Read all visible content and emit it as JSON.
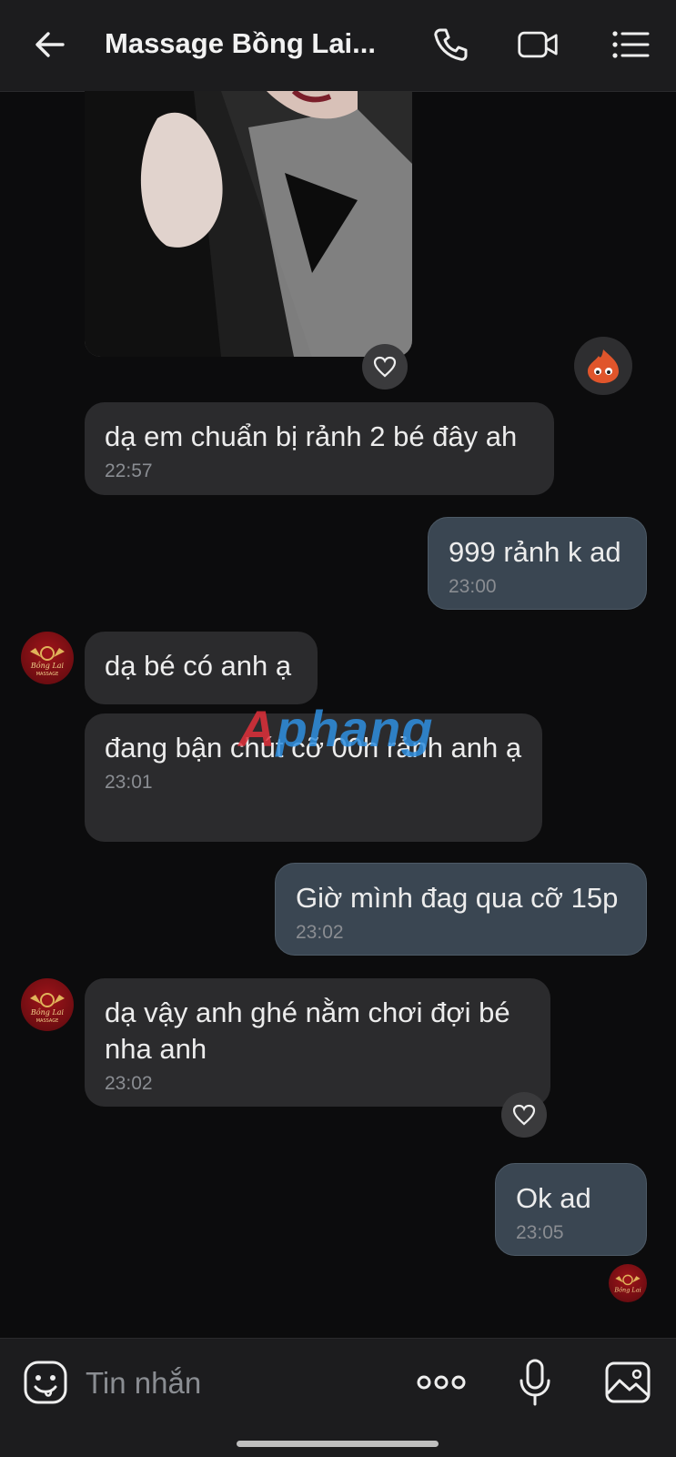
{
  "header": {
    "title": "Massage Bồng Lai...",
    "icons": [
      "back-arrow-icon",
      "phone-icon",
      "video-icon",
      "menu-list-icon"
    ]
  },
  "messages": [
    {
      "direction": "incoming",
      "text": "dạ em chuẩn bị rảnh 2 bé đây ah",
      "time": "22:57"
    },
    {
      "direction": "outgoing",
      "text": "999 rảnh k ad",
      "time": "23:00"
    },
    {
      "direction": "incoming",
      "text": "dạ bé có anh ạ",
      "time": ""
    },
    {
      "direction": "incoming",
      "text": "đang bận chút cỡ 00h rảnh anh ạ",
      "time": "23:01"
    },
    {
      "direction": "outgoing",
      "text": "Giờ mình đag qua cỡ 15p",
      "time": "23:02"
    },
    {
      "direction": "incoming",
      "text": "dạ vậy anh ghé nằm chơi đợi bé nha anh",
      "time": "23:02"
    },
    {
      "direction": "outgoing",
      "text": "Ok ad",
      "time": "23:05"
    }
  ],
  "avatar_text": "Bồng Lai MASSAGE",
  "watermark": "Aphang",
  "input": {
    "placeholder": "Tin nhắn",
    "icons": [
      "sticker-icon",
      "more-options-icon",
      "microphone-icon",
      "image-icon"
    ]
  },
  "colors": {
    "background": "#0c0c0d",
    "incoming_bubble": "#2b2b2d",
    "outgoing_bubble": "#3a4652",
    "avatar": "#a0141a"
  }
}
